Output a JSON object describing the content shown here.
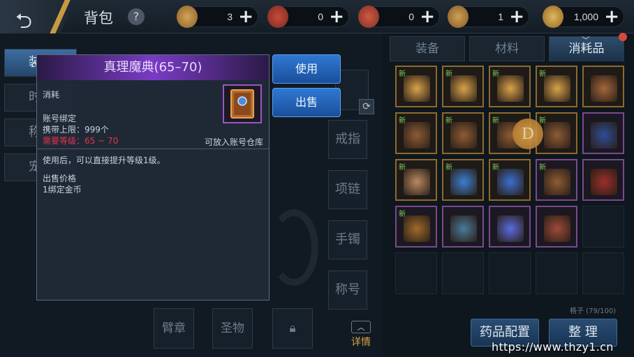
{
  "header": {
    "title": "背包",
    "help_label": "?",
    "currencies": [
      {
        "icon": "coin-bag-icon",
        "value": "3",
        "add": "+"
      },
      {
        "icon": "scroll-ticket-icon",
        "value": "0",
        "add": "+"
      },
      {
        "icon": "scroll-ticket-2-icon",
        "value": "0",
        "add": "+"
      },
      {
        "icon": "token-icon",
        "value": "1",
        "add": "+"
      },
      {
        "icon": "gold-coin-icon",
        "value": "1,000",
        "add": "+"
      }
    ]
  },
  "left_tabs": [
    "装",
    "时",
    "称",
    "宠"
  ],
  "equip_slots": [
    "戒指",
    "项链",
    "手镯",
    "称号"
  ],
  "bottom_slots": [
    "臂章",
    "圣物"
  ],
  "detail_label": "详情",
  "refresh_label": "⟳",
  "category_tabs": [
    {
      "label": "装备",
      "active": false
    },
    {
      "label": "材料",
      "active": false
    },
    {
      "label": "消耗品",
      "active": true
    }
  ],
  "grid": {
    "new_badge": "新",
    "items": [
      {
        "new": true,
        "frame": "gold",
        "color": "#d9a24a"
      },
      {
        "new": true,
        "frame": "gold",
        "color": "#d9a24a"
      },
      {
        "new": true,
        "frame": "gold",
        "color": "#d9a24a"
      },
      {
        "new": true,
        "frame": "gold",
        "color": "#d9a24a"
      },
      {
        "new": false,
        "frame": "gold",
        "color": "#a4673a"
      },
      {
        "new": true,
        "frame": "gold",
        "color": "#8e5c34"
      },
      {
        "new": true,
        "frame": "gold",
        "color": "#8e5c34"
      },
      {
        "new": true,
        "frame": "gold",
        "color": "#8e5c34"
      },
      {
        "new": true,
        "frame": "gold",
        "color": "#8e5c34"
      },
      {
        "new": false,
        "frame": "purple",
        "color": "#2f4d9a"
      },
      {
        "new": true,
        "frame": "gold",
        "color": "#b88a62"
      },
      {
        "new": true,
        "frame": "gold",
        "color": "#3b7fd1"
      },
      {
        "new": true,
        "frame": "gold",
        "color": "#3b6fcf"
      },
      {
        "new": true,
        "frame": "purple",
        "color": "#8e5c34"
      },
      {
        "new": false,
        "frame": "purple",
        "color": "#9b2f2a"
      },
      {
        "new": true,
        "frame": "purple",
        "color": "#a06a2c"
      },
      {
        "new": false,
        "frame": "purple",
        "color": "#4a7a9a"
      },
      {
        "new": false,
        "frame": "purple",
        "color": "#5a6ce0"
      },
      {
        "new": false,
        "frame": "purple",
        "color": "#a04a3a"
      }
    ]
  },
  "coin_overlay": "D",
  "bag_count": "格子 (79/100)",
  "bottom_buttons": [
    "药品配置",
    "整 理"
  ],
  "watermark": "https://www.thzy1.cn",
  "tooltip": {
    "title": "真理魔典(65–70)",
    "type": "消耗",
    "bind": "账号绑定",
    "carry_limit": "携带上限：999个",
    "level_req": "需要等级：65 ~ 70",
    "warehouse": "可放入账号仓库",
    "description": "使用后，可以直接提升等级1级。",
    "price_label": "出售价格",
    "price_value": "1绑定金币"
  },
  "actions": {
    "use": "使用",
    "sell": "出售"
  },
  "colors": {
    "accent_blue": "#2f78d4",
    "rarity_purple": "#7a3bc4",
    "warning_red": "#e2344a",
    "gold": "#d7a548"
  }
}
